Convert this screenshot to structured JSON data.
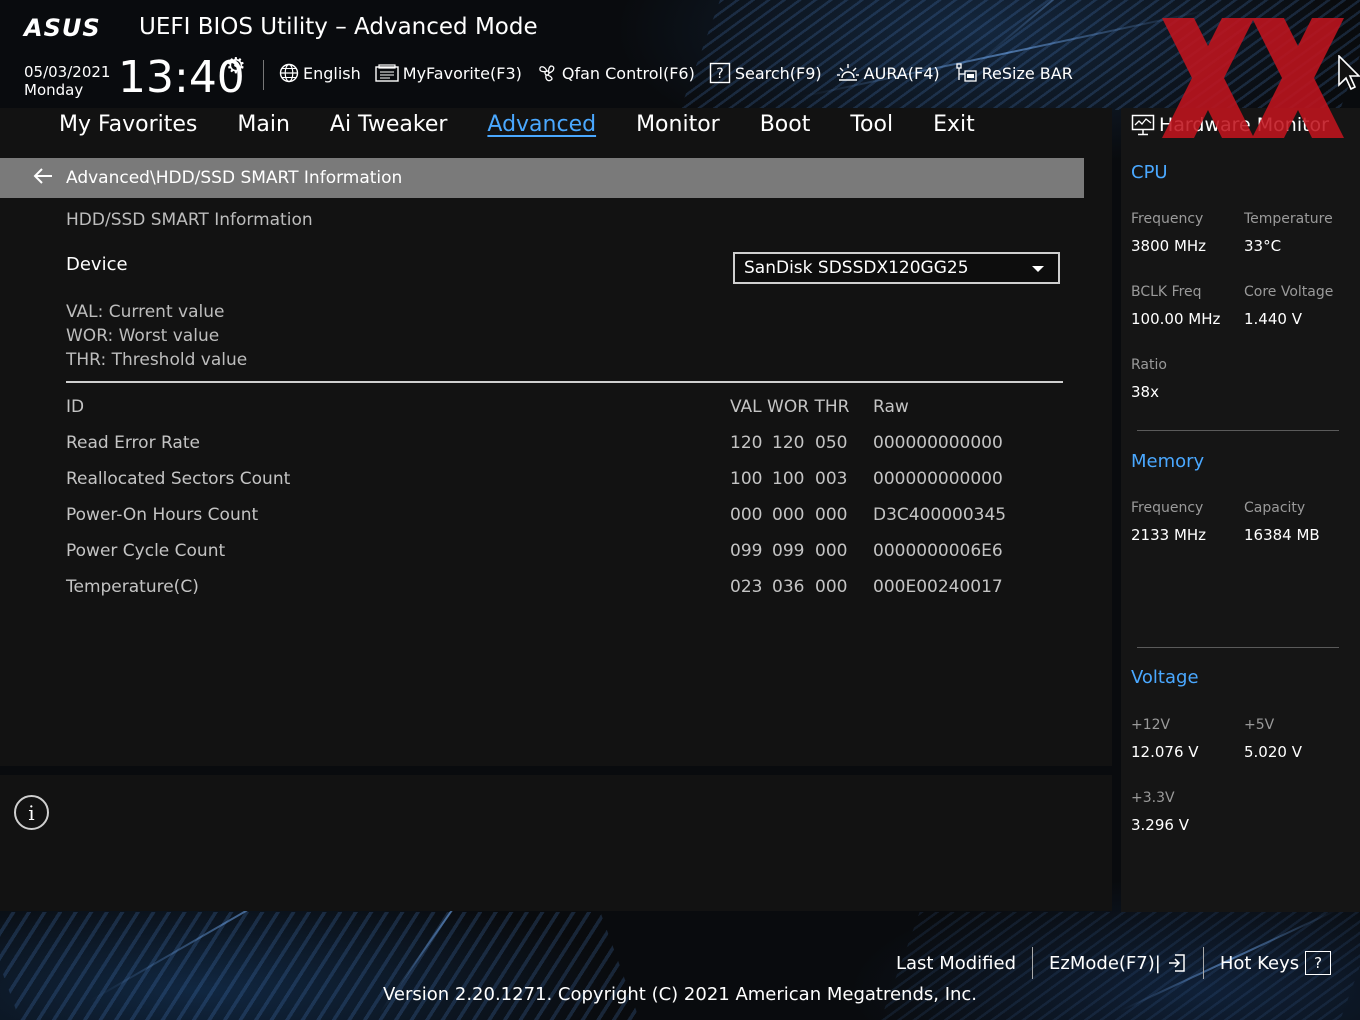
{
  "header": {
    "logo": "ASUS",
    "title": "UEFI BIOS Utility – Advanced Mode",
    "date": "05/03/2021",
    "day": "Monday",
    "time": "13:40"
  },
  "toolbar": [
    {
      "icon": "globe-icon",
      "label": "English"
    },
    {
      "icon": "favorite-list-icon",
      "label": "MyFavorite(F3)"
    },
    {
      "icon": "fan-icon",
      "label": "Qfan Control(F6)"
    },
    {
      "icon": "search-help-icon",
      "label": "Search(F9)"
    },
    {
      "icon": "aura-light-icon",
      "label": "AURA(F4)"
    },
    {
      "icon": "resize-bar-icon",
      "label": "ReSize BAR"
    }
  ],
  "tabs": [
    {
      "label": "My Favorites",
      "active": false
    },
    {
      "label": "Main",
      "active": false
    },
    {
      "label": "Ai Tweaker",
      "active": false
    },
    {
      "label": "Advanced",
      "active": true
    },
    {
      "label": "Monitor",
      "active": false
    },
    {
      "label": "Boot",
      "active": false
    },
    {
      "label": "Tool",
      "active": false
    },
    {
      "label": "Exit",
      "active": false
    }
  ],
  "breadcrumb": "Advanced\\HDD/SSD SMART Information",
  "section_title": "HDD/SSD SMART Information",
  "device": {
    "label": "Device",
    "value": "SanDisk SDSSDX120GG25"
  },
  "legend": [
    "VAL: Current value",
    "WOR: Worst value",
    "THR: Threshold value"
  ],
  "smart_table": {
    "header": {
      "name": "ID",
      "cols": "VAL WOR THR",
      "raw": "Raw"
    },
    "rows": [
      {
        "name": "Read Error Rate",
        "val": "120",
        "wor": "120",
        "thr": "050",
        "raw": "000000000000"
      },
      {
        "name": "Reallocated Sectors Count",
        "val": "100",
        "wor": "100",
        "thr": "003",
        "raw": "000000000000"
      },
      {
        "name": "Power-On Hours Count",
        "val": "000",
        "wor": "000",
        "thr": "000",
        "raw": "D3C400000345"
      },
      {
        "name": "Power Cycle Count",
        "val": "099",
        "wor": "099",
        "thr": "000",
        "raw": "0000000006E6"
      },
      {
        "name": "Temperature(C)",
        "val": "023",
        "wor": "036",
        "thr": "000",
        "raw": "000E00240017"
      }
    ]
  },
  "hw_monitor": {
    "title": "Hardware Monitor",
    "cpu": {
      "heading": "CPU",
      "frequency_label": "Frequency",
      "frequency": "3800 MHz",
      "temperature_label": "Temperature",
      "temperature": "33°C",
      "bclk_label": "BCLK Freq",
      "bclk": "100.00 MHz",
      "core_voltage_label": "Core Voltage",
      "core_voltage": "1.440 V",
      "ratio_label": "Ratio",
      "ratio": "38x"
    },
    "memory": {
      "heading": "Memory",
      "frequency_label": "Frequency",
      "frequency": "2133 MHz",
      "capacity_label": "Capacity",
      "capacity": "16384 MB"
    },
    "voltage": {
      "heading": "Voltage",
      "v12_label": "+12V",
      "v12": "12.076 V",
      "v5_label": "+5V",
      "v5": "5.020 V",
      "v33_label": "+3.3V",
      "v33": "3.296 V"
    }
  },
  "footer": {
    "last_modified": "Last Modified",
    "ezmode": "EzMode(F7)|",
    "hotkeys": "Hot Keys",
    "hotkeys_icon": "?",
    "version": "Version 2.20.1271. Copyright (C) 2021 American Megatrends, Inc."
  },
  "colors": {
    "accent": "#4aa8ff",
    "breadcrumb_bg": "#7a7a7a",
    "panel_bg": "#121212",
    "watermark": "#c0141e"
  }
}
